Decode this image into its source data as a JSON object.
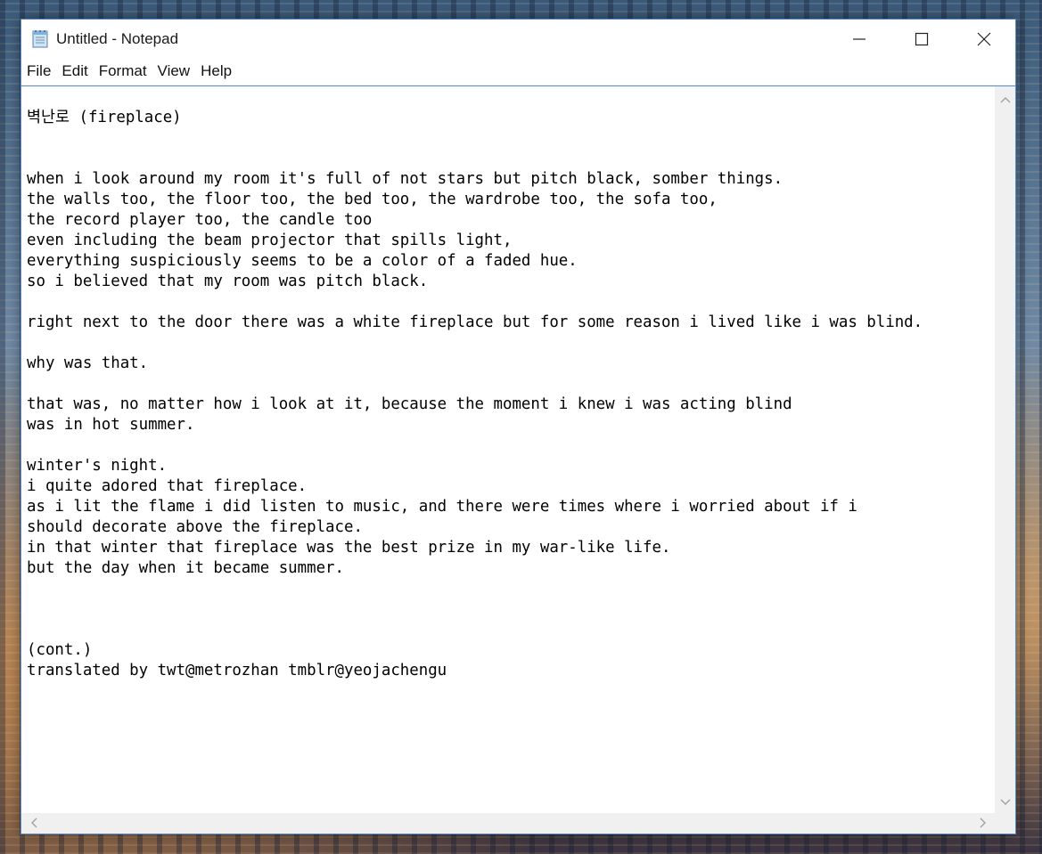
{
  "window": {
    "title": "Untitled - Notepad"
  },
  "menu": {
    "file": "File",
    "edit": "Edit",
    "format": "Format",
    "view": "View",
    "help": "Help"
  },
  "document": {
    "lines": [
      "벽난로 (fireplace)",
      "",
      "",
      "when i look around my room it's full of not stars but pitch black, somber things.",
      "the walls too, the floor too, the bed too, the wardrobe too, the sofa too,",
      "the record player too, the candle too",
      "even including the beam projector that spills light,",
      "everything suspiciously seems to be a color of a faded hue.",
      "so i believed that my room was pitch black.",
      "",
      "right next to the door there was a white fireplace but for some reason i lived like i was blind.",
      "",
      "why was that.",
      "",
      "that was, no matter how i look at it, because the moment i knew i was acting blind",
      "was in hot summer.",
      "",
      "winter's night.",
      "i quite adored that fireplace.",
      "as i lit the flame i did listen to music, and there were times where i worried about if i",
      "should decorate above the fireplace.",
      "in that winter that fireplace was the best prize in my war-like life.",
      "but the day when it became summer.",
      "",
      "",
      "",
      "(cont.)",
      "translated by twt@metrozhan tmblr@yeojachengu"
    ]
  },
  "colors": {
    "accent_border": "#5b8fc9",
    "scrollbar_bg": "#f0f0f0"
  },
  "icons": {
    "app": "notepad-icon",
    "minimize": "minimize-icon",
    "maximize": "maximize-icon",
    "close": "close-icon"
  }
}
